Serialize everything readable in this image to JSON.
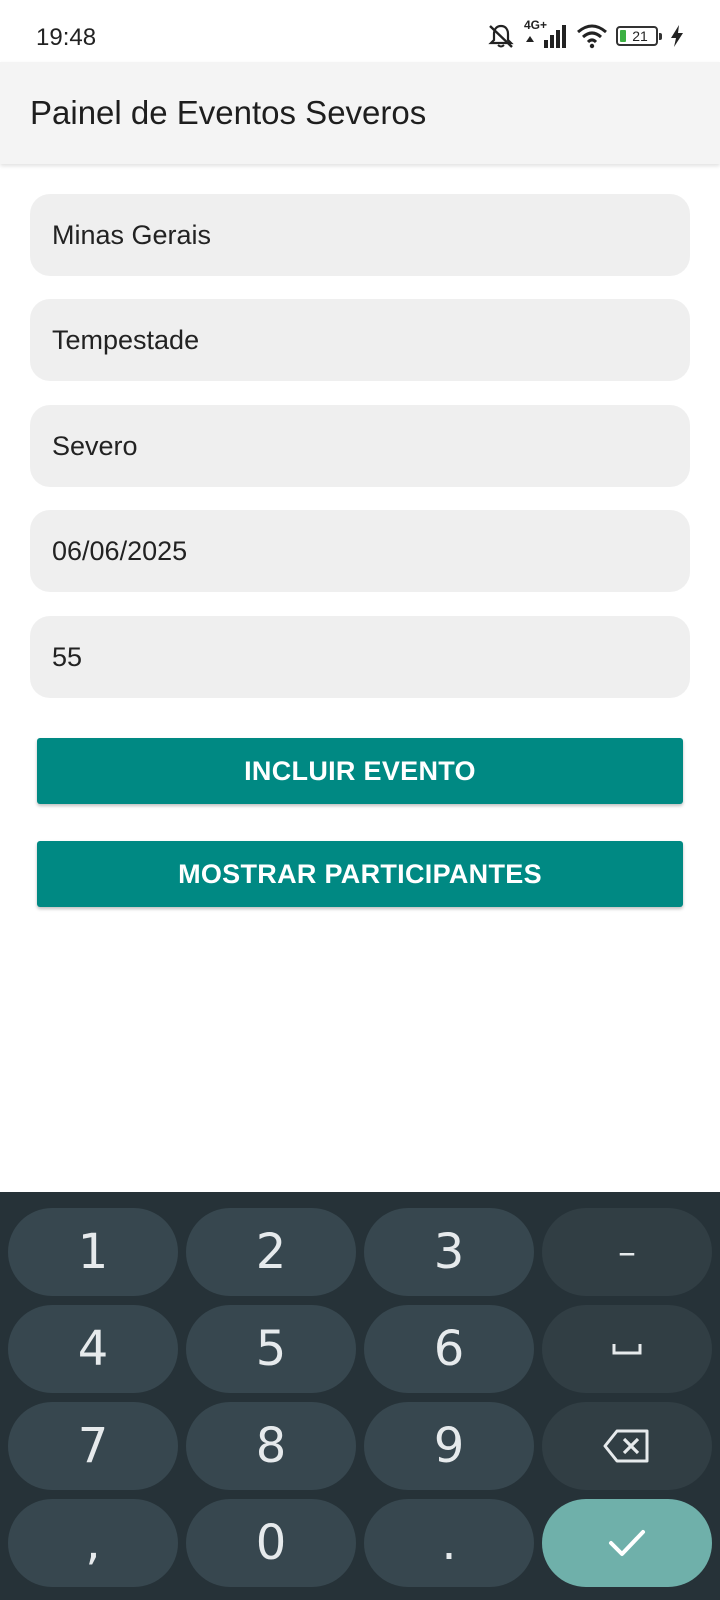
{
  "status_bar": {
    "time": "19:48",
    "network_label": "4G+",
    "battery_level": "21",
    "icons": [
      "silent-alarm-icon",
      "signal-icon",
      "wifi-icon",
      "battery-icon",
      "charging-icon"
    ]
  },
  "app_bar": {
    "title": "Painel de Eventos Severos"
  },
  "form": {
    "state": "Minas Gerais",
    "event_type": "Tempestade",
    "severity": "Severo",
    "date": "06/06/2025",
    "participants": "55"
  },
  "buttons": {
    "include_event": "INCLUIR EVENTO",
    "show_participants": "MOSTRAR PARTICIPANTES"
  },
  "keyboard": {
    "keys": {
      "k1": "1",
      "k2": "2",
      "k3": "3",
      "minus": "–",
      "k4": "4",
      "k5": "5",
      "k6": "6",
      "k7": "7",
      "k8": "8",
      "k9": "9",
      "comma": ",",
      "k0": "0",
      "period": "."
    },
    "icons": [
      "space-icon",
      "backspace-icon",
      "check-icon"
    ]
  },
  "colors": {
    "accent": "#008983",
    "app_bar_bg": "#f4f4f4",
    "field_bg": "#efefef",
    "keyboard_bg": "#263238",
    "key_bg": "#37474f",
    "enter_key_bg": "#6fb0aa",
    "battery_fill": "#3cb043"
  }
}
